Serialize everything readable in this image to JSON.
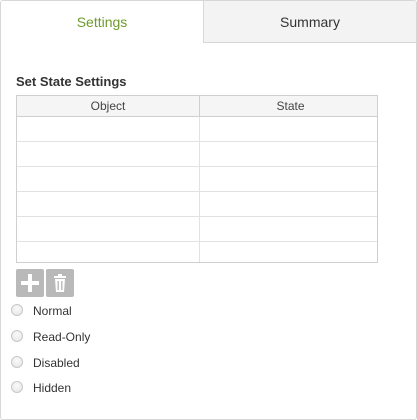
{
  "tabs": [
    {
      "label": "Settings",
      "active": true
    },
    {
      "label": "Summary",
      "active": false
    }
  ],
  "section_title": "Set State Settings",
  "table": {
    "columns": [
      "Object",
      "State"
    ],
    "rows": [
      {
        "object": "",
        "state": ""
      },
      {
        "object": "",
        "state": ""
      },
      {
        "object": "",
        "state": ""
      },
      {
        "object": "",
        "state": ""
      },
      {
        "object": "",
        "state": ""
      },
      {
        "object": "",
        "state": ""
      }
    ]
  },
  "toolbar": {
    "add_icon": "plus-icon",
    "delete_icon": "trash-icon"
  },
  "states": [
    {
      "label": "Normal",
      "checked": false
    },
    {
      "label": "Read-Only",
      "checked": false
    },
    {
      "label": "Disabled",
      "checked": false
    },
    {
      "label": "Hidden",
      "checked": false
    }
  ],
  "colors": {
    "active_tab": "#6e9b2d",
    "toolbar_button": "#b9b9b9"
  }
}
